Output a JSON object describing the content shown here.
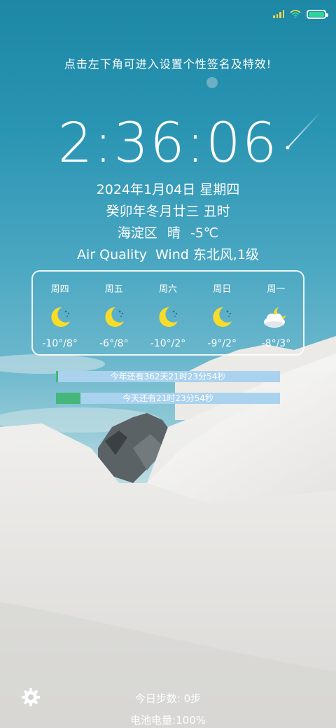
{
  "hint": "点击左下角可进入设置个性签名及特效!",
  "clock": "2:36:06",
  "date_line": "2024年1月04日 星期四",
  "lunar_line": "癸卯年冬月廿三 丑时",
  "weather": {
    "district": "海淀区",
    "condition": "晴",
    "temperature": "-5℃"
  },
  "air_quality": {
    "label": "Air Quality",
    "wind": "Wind 东北风,1级"
  },
  "forecast": [
    {
      "day": "周四",
      "icon": "moon-icon",
      "temp": "-10°/8°"
    },
    {
      "day": "周五",
      "icon": "moon-icon",
      "temp": "-6°/8°"
    },
    {
      "day": "周六",
      "icon": "moon-icon",
      "temp": "-10°/2°"
    },
    {
      "day": "周日",
      "icon": "moon-icon",
      "temp": "-9°/2°"
    },
    {
      "day": "周一",
      "icon": "partly-cloudy-night-icon",
      "temp": "-8°/3°"
    }
  ],
  "year_progress": {
    "label": "今年还有362天21时23分54秒",
    "fraction": 0.01
  },
  "day_progress": {
    "label": "今天还有21时23分54秒",
    "fraction": 0.108
  },
  "steps": "今日步数: 0步",
  "battery": "电池电量:100%",
  "colors": {
    "progress_track": "#a9d2ee",
    "progress_fill": "#45b77a",
    "moon": "#f7dc2a",
    "battery_fill": "#2bd69a"
  }
}
